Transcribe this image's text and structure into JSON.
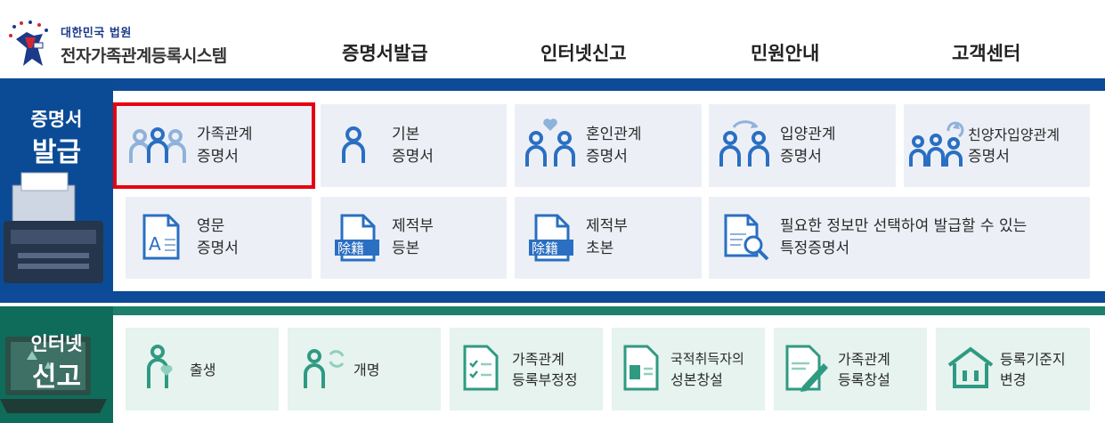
{
  "header": {
    "logo_small": "대한민국 법원",
    "logo_title": "전자가족관계등록시스템",
    "nav": [
      "증명서발급",
      "인터넷신고",
      "민원안내",
      "고객센터"
    ]
  },
  "certificates": {
    "side_title_line1": "증명서",
    "side_title_line2": "발급",
    "tiles": [
      {
        "line1": "가족관계",
        "line2": "증명서"
      },
      {
        "line1": "기본",
        "line2": "증명서"
      },
      {
        "line1": "혼인관계",
        "line2": "증명서"
      },
      {
        "line1": "입양관계",
        "line2": "증명서"
      },
      {
        "line1": "친양자입양관계",
        "line2": "증명서"
      },
      {
        "line1": "영문",
        "line2": "증명서"
      },
      {
        "line1": "제적부",
        "line2": "등본"
      },
      {
        "line1": "제적부",
        "line2": "초본"
      },
      {
        "line1": "필요한 정보만 선택하여 발급할 수 있는",
        "line2": "특정증명서"
      }
    ],
    "stamp_text": "除籍",
    "doc_letter": "A"
  },
  "reports": {
    "side_title_line1": "인터넷",
    "side_title_line2": "신고",
    "tiles": [
      {
        "line1": "출생",
        "line2": ""
      },
      {
        "line1": "개명",
        "line2": ""
      },
      {
        "line1": "가족관계",
        "line2": "등록부정정"
      },
      {
        "line1": "국적취득자의",
        "line2": "성본창설"
      },
      {
        "line1": "가족관계",
        "line2": "등록창설"
      },
      {
        "line1": "등록기준지",
        "line2": "변경"
      }
    ]
  },
  "colors": {
    "cert_blue": "#0d4a97",
    "cert_icon": "#2a6fc2",
    "report_green": "#1e7f6a",
    "report_icon": "#2f9a82",
    "selected_border": "#e60012"
  }
}
